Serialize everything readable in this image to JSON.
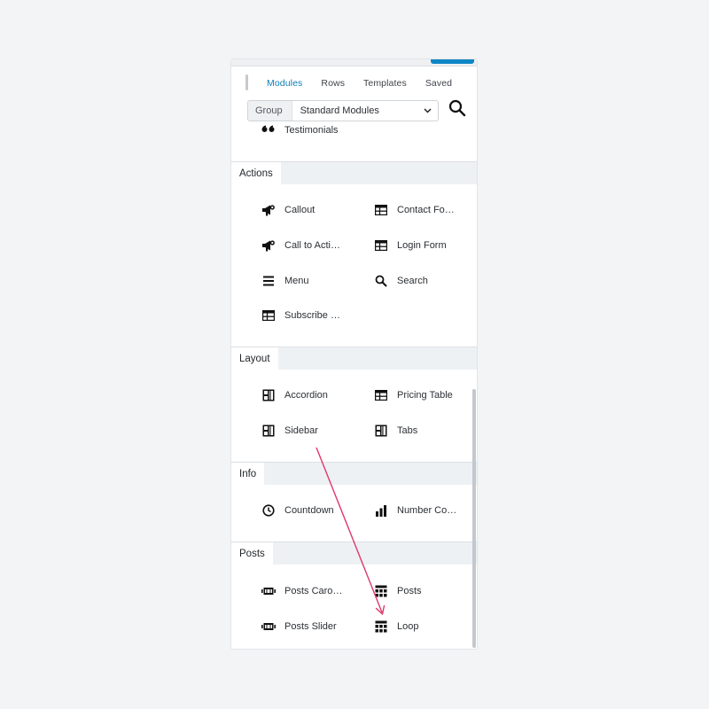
{
  "tabs": [
    "Modules",
    "Rows",
    "Templates",
    "Saved"
  ],
  "active_tab": "Modules",
  "group": {
    "label": "Group",
    "value": "Standard Modules"
  },
  "top_module": {
    "label": "Testimonials",
    "icon": "quote-icon"
  },
  "sections": [
    {
      "title": "Actions",
      "modules": [
        {
          "label": "Callout",
          "icon": "megaphone-icon"
        },
        {
          "label": "Contact Fo…",
          "icon": "table-icon"
        },
        {
          "label": "Call to Acti…",
          "icon": "megaphone-icon"
        },
        {
          "label": "Login Form",
          "icon": "table-icon"
        },
        {
          "label": "Menu",
          "icon": "menu-icon"
        },
        {
          "label": "Search",
          "icon": "search-icon"
        },
        {
          "label": "Subscribe …",
          "icon": "table-icon"
        }
      ]
    },
    {
      "title": "Layout",
      "modules": [
        {
          "label": "Accordion",
          "icon": "layout-icon"
        },
        {
          "label": "Pricing Table",
          "icon": "table-icon"
        },
        {
          "label": "Sidebar",
          "icon": "layout-icon"
        },
        {
          "label": "Tabs",
          "icon": "layout-icon"
        }
      ]
    },
    {
      "title": "Info",
      "modules": [
        {
          "label": "Countdown",
          "icon": "clock-icon"
        },
        {
          "label": "Number Co…",
          "icon": "bar-chart-icon"
        }
      ]
    },
    {
      "title": "Posts",
      "modules": [
        {
          "label": "Posts Caro…",
          "icon": "carousel-icon"
        },
        {
          "label": "Posts",
          "icon": "grid-icon"
        },
        {
          "label": "Posts Slider",
          "icon": "carousel-icon"
        },
        {
          "label": "Loop",
          "icon": "grid-icon"
        }
      ]
    }
  ],
  "colors": {
    "accent": "#0e86c6",
    "arrow": "#e0386a"
  }
}
